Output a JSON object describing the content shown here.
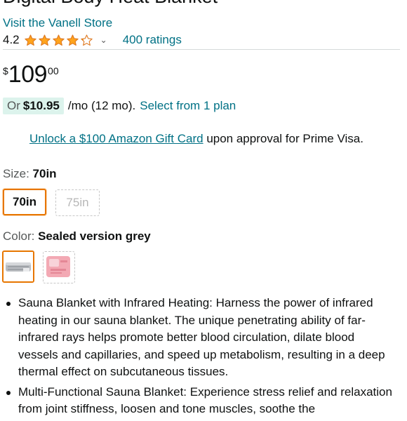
{
  "product": {
    "title": "Digital Body Heat Blanket",
    "store_link": "Visit the Vanell Store"
  },
  "rating": {
    "value": "4.2",
    "stars": 4.2,
    "ratings_count": "400 ratings",
    "star_color": "#ffa41c"
  },
  "price": {
    "currency_symbol": "$",
    "whole": "109",
    "fraction": "00"
  },
  "installment": {
    "prefix": "Or",
    "amount": "$10.95",
    "term": "/mo (12 mo).",
    "link": "Select from 1 plan",
    "badge_color": "#dcf3ec"
  },
  "gift_card": {
    "link": "Unlock a $100 Amazon Gift Card",
    "suffix": "upon approval for Prime Visa."
  },
  "size": {
    "label": "Size:",
    "selected": "70in",
    "options": [
      "70in",
      "75in"
    ]
  },
  "color": {
    "label": "Color:",
    "selected": "Sealed version grey",
    "swatches": [
      "grey",
      "pink"
    ]
  },
  "bullets": [
    "Sauna Blanket with Infrared Heating: Harness the power of infrared heating in our sauna blanket. The unique penetrating ability of far-infrared rays helps promote better blood circulation, dilate blood vessels and capillaries, and speed up metabolism, resulting in a deep thermal effect on subcutaneous tissues.",
    "Multi-Functional Sauna Blanket: Experience stress relief and relaxation from joint stiffness, loosen and tone muscles, soothe the"
  ]
}
